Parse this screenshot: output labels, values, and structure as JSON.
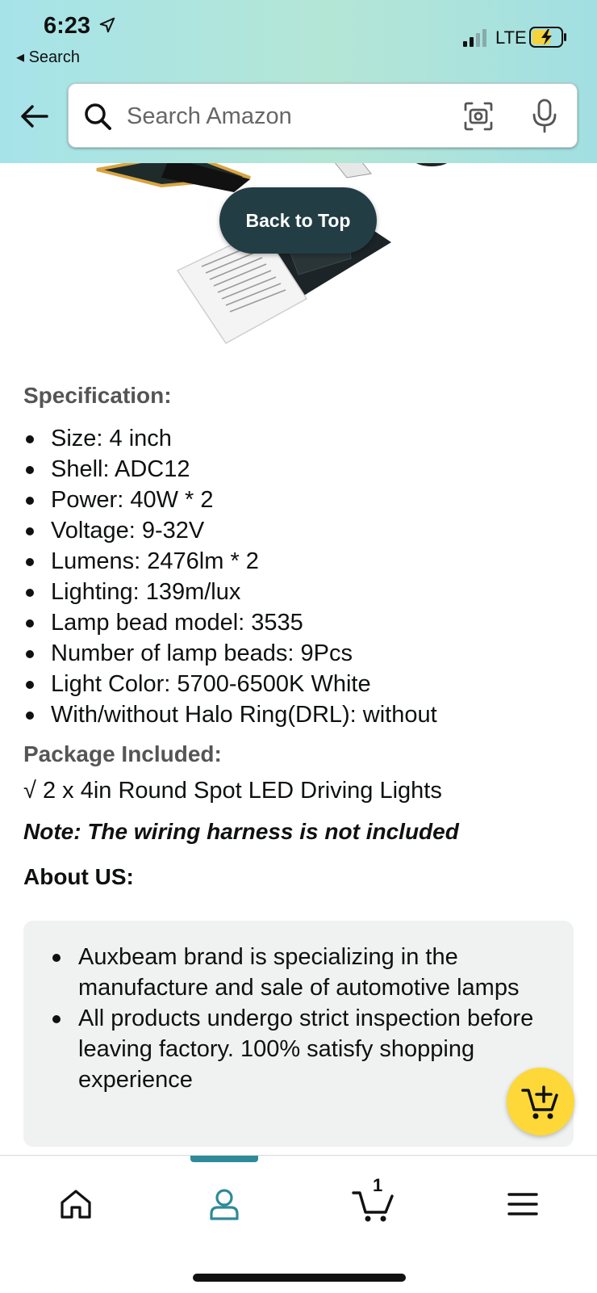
{
  "status_bar": {
    "time": "6:23",
    "back_app": "◂ Search",
    "network": "LTE"
  },
  "header": {
    "search_placeholder": "Search Amazon"
  },
  "back_to_top": "Back to Top",
  "specification": {
    "title": "Specification:",
    "items": [
      "Size: 4 inch",
      "Shell: ADC12",
      "Power: 40W * 2",
      "Voltage: 9-32V",
      "Lumens: 2476lm * 2",
      "Lighting: 139m/lux",
      "Lamp bead model: 3535",
      "Number of lamp beads: 9Pcs",
      "Light Color: 5700-6500K White",
      "With/without Halo Ring(DRL): without"
    ]
  },
  "package": {
    "title": "Package Included:",
    "line": "√ 2 x 4in Round Spot LED Driving Lights"
  },
  "note": "Note: The wiring harness is not included",
  "about": {
    "title": "About US:",
    "items": [
      "Auxbeam brand is specializing in the manufacture and sale of automotive lamps",
      "All products undergo strict inspection before leaving factory. 100% satisfy shopping experience"
    ]
  },
  "bottom_nav": {
    "cart_count": "1",
    "active_tab": "account"
  },
  "colors": {
    "header_gradient_start": "#a6e3e9",
    "back_to_top_bg": "#233d44",
    "fab_bg": "#fed838",
    "active_indicator": "#2e8a99"
  },
  "icons": [
    "location-arrow-icon",
    "signal-icon",
    "battery-charging-icon",
    "back-arrow-icon",
    "search-icon",
    "camera-icon",
    "microphone-icon",
    "add-to-cart-icon",
    "home-icon",
    "account-icon",
    "cart-icon",
    "menu-icon"
  ]
}
